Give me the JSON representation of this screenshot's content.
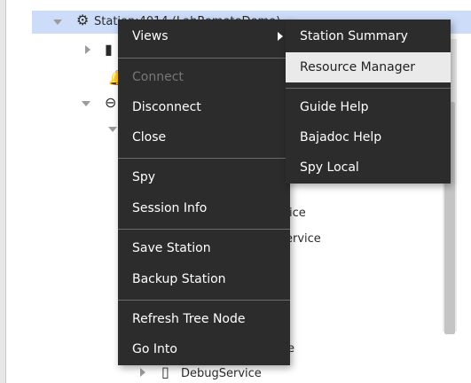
{
  "tree": {
    "station_label": "Station:4014 (LabRemoteDemo)",
    "partial_1": "ice",
    "partial_2": "ervice",
    "partial_3": "e",
    "debug_service": "DebugService"
  },
  "context_menu": {
    "items": [
      {
        "label": "Views"
      },
      {
        "label": "Connect"
      },
      {
        "label": "Disconnect"
      },
      {
        "label": "Close"
      },
      {
        "label": "Spy"
      },
      {
        "label": "Session Info"
      },
      {
        "label": "Save Station"
      },
      {
        "label": "Backup Station"
      },
      {
        "label": "Refresh Tree Node"
      },
      {
        "label": "Go Into"
      }
    ]
  },
  "views_submenu": {
    "items": [
      {
        "label": "Station Summary"
      },
      {
        "label": "Resource Manager"
      },
      {
        "label": "Guide Help"
      },
      {
        "label": "Bajadoc Help"
      },
      {
        "label": "Spy Local"
      }
    ]
  },
  "colors": {
    "menu_bg": "#2c2c2c",
    "selection": "#cddcf8",
    "highlight": "#eaeaea"
  }
}
